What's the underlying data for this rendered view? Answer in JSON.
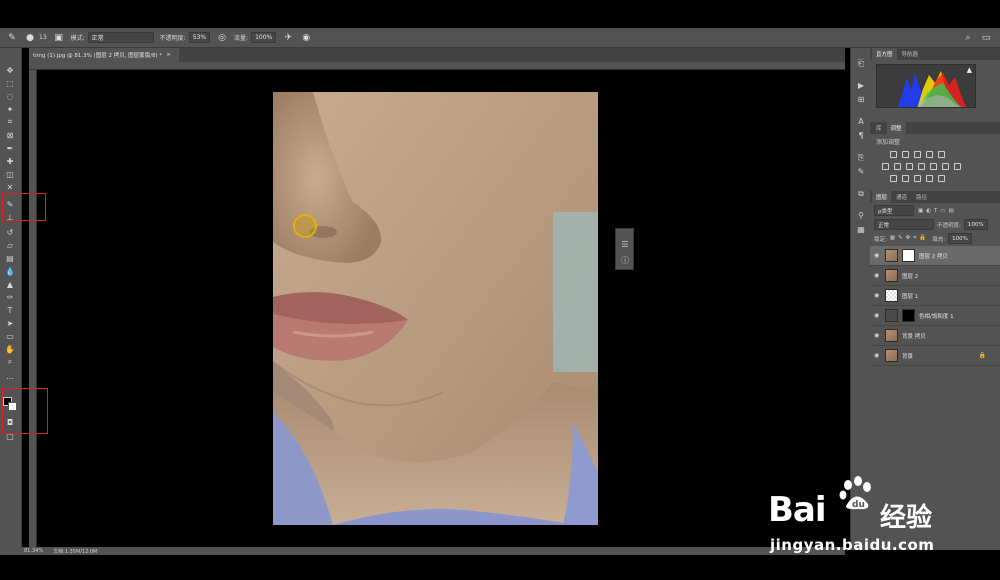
{
  "options_bar": {
    "brush_size": "13",
    "mode_label": "模式:",
    "mode_value": "正常",
    "opacity_label": "不透明度:",
    "opacity_value": "53%",
    "flow_label": "流量:",
    "flow_value": "100%"
  },
  "document_tab": {
    "title": "timg (1).jpg @ 81.3% (图层 2 拷贝, 图层蒙版/8) *",
    "close": "×"
  },
  "status_bar": {
    "zoom": "81.34%",
    "doc_info": "文档:1.35M/12.0M"
  },
  "histogram_panel": {
    "tabs": [
      "直方图",
      "导航器"
    ],
    "warning": "▲"
  },
  "adjustments_panel": {
    "tabs": [
      "库",
      "调整"
    ],
    "header": "添加调整"
  },
  "layers_panel": {
    "tabs": [
      "图层",
      "通道",
      "路径"
    ],
    "filter_label": "ρ类型",
    "blend_mode": "正常",
    "opacity_label": "不透明度:",
    "opacity_value": "100%",
    "lock_label": "锁定:",
    "fill_label": "填充:",
    "fill_value": "100%",
    "layers": [
      {
        "name": "图层 2 拷贝",
        "selected": true
      },
      {
        "name": "图层 2",
        "selected": false
      },
      {
        "name": "图层 1",
        "selected": false
      },
      {
        "name": "色相/饱和度 1",
        "selected": false
      },
      {
        "name": "背景 拷贝",
        "selected": false
      },
      {
        "name": "背景",
        "selected": false
      }
    ]
  },
  "watermark": {
    "brand": "Bai",
    "brand2": "经验",
    "url": "jingyan.baidu.com"
  },
  "colors": {
    "ui_panel": "#535353",
    "highlight_box": "#e02020",
    "brush_cursor": "#e2b10b"
  }
}
